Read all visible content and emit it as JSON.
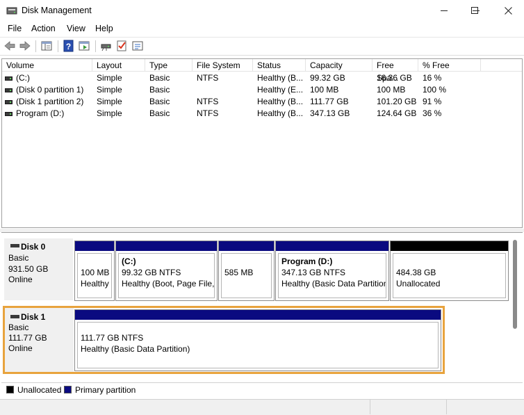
{
  "window": {
    "title": "Disk Management"
  },
  "menu": [
    {
      "label": "File"
    },
    {
      "label": "Action"
    },
    {
      "label": "View"
    },
    {
      "label": "Help"
    }
  ],
  "volume_list": {
    "columns": [
      "Volume",
      "Layout",
      "Type",
      "File System",
      "Status",
      "Capacity",
      "Free Spa...",
      "% Free"
    ],
    "rows": [
      {
        "volume": "(C:)",
        "layout": "Simple",
        "type": "Basic",
        "fs": "NTFS",
        "status": "Healthy (B...",
        "capacity": "99.32 GB",
        "free": "16.36 GB",
        "pct": "16 %"
      },
      {
        "volume": "(Disk 0 partition 1)",
        "layout": "Simple",
        "type": "Basic",
        "fs": "",
        "status": "Healthy (E...",
        "capacity": "100 MB",
        "free": "100 MB",
        "pct": "100 %"
      },
      {
        "volume": "(Disk 1 partition 2)",
        "layout": "Simple",
        "type": "Basic",
        "fs": "NTFS",
        "status": "Healthy (B...",
        "capacity": "111.77 GB",
        "free": "101.20 GB",
        "pct": "91 %"
      },
      {
        "volume": "Program (D:)",
        "layout": "Simple",
        "type": "Basic",
        "fs": "NTFS",
        "status": "Healthy (B...",
        "capacity": "347.13 GB",
        "free": "124.64 GB",
        "pct": "36 %"
      }
    ]
  },
  "disks": [
    {
      "name": "Disk 0",
      "type": "Basic",
      "size": "931.50 GB",
      "state": "Online",
      "partitions": [
        {
          "name": "",
          "line1": "100 MB",
          "line2": "Healthy",
          "bar": "primary"
        },
        {
          "name": "(C:)",
          "line1": "99.32 GB NTFS",
          "line2": "Healthy (Boot, Page File,",
          "bar": "primary"
        },
        {
          "name": "",
          "line1": "585 MB",
          "line2": "",
          "bar": "primary"
        },
        {
          "name": "Program  (D:)",
          "line1": "347.13 GB NTFS",
          "line2": "Healthy (Basic Data Partition",
          "bar": "primary"
        },
        {
          "name": "",
          "line1": "484.38 GB",
          "line2": "Unallocated",
          "bar": "unallocated"
        }
      ]
    },
    {
      "name": "Disk 1",
      "type": "Basic",
      "size": "111.77 GB",
      "state": "Online",
      "partitions": [
        {
          "name": "",
          "line1": "111.77 GB NTFS",
          "line2": "Healthy (Basic Data Partition)",
          "bar": "primary"
        }
      ]
    }
  ],
  "legend": [
    {
      "label": "Unallocated",
      "color": "#000000"
    },
    {
      "label": "Primary partition",
      "color": "#0a0a80"
    }
  ],
  "colors": {
    "primary": "#0a0a80",
    "unallocated": "#000000",
    "selection": "#e8a33d"
  }
}
